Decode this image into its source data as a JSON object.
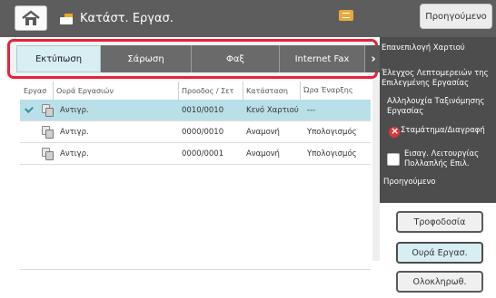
{
  "header": {
    "title": "Κατάστ. Εργασ.",
    "prev_label": "Προηγούμενο"
  },
  "tabs": [
    {
      "label": "Εκτύπωση",
      "active": true
    },
    {
      "label": "Σάρωση",
      "active": false
    },
    {
      "label": "Φαξ",
      "active": false
    },
    {
      "label": "Internet Fax",
      "active": false
    }
  ],
  "table": {
    "columns": [
      "Εργασ",
      "Ουρά Εργασιών",
      "Προοδος / Σετ",
      "Κατάσταση",
      "Ώρα Έναρξης"
    ],
    "rows": [
      {
        "name": "Αντιγρ.",
        "progress": "0010/0010",
        "status": "Κενό Χαρτιού",
        "start": "---",
        "selected": true
      },
      {
        "name": "Αντιγρ.",
        "progress": "0000/0010",
        "status": "Αναμονή",
        "start": "Υπολογισμός",
        "selected": false
      },
      {
        "name": "Αντιγρ.",
        "progress": "0000/0001",
        "status": "Αναμονή",
        "start": "Υπολογισμός",
        "selected": false
      }
    ]
  },
  "side_menu": {
    "items": [
      "Επανεπιλογή Χαρτιού",
      "Έλεγχος Λεπτομερειών της Επιλεγμένης Εργασίας",
      "Αλληλουχία Ταξινόμησης Εργασίας",
      "Σταμάτημα/Διαγραφή",
      "Εισαγ. Λειτουργίας Πολλαπλής Επιλ.",
      "Προηγούμενο"
    ]
  },
  "buttons": {
    "tray": "Τροφοδοσία",
    "queue": "Ουρά Εργασ.",
    "completed": "Ολοκληρωθ."
  },
  "colors": {
    "highlight_frame": "#e8223c",
    "selected_row": "#b9e0e8",
    "active_tab": "#d7eef3",
    "topbar": "#5d5d5d",
    "side_panel": "#4d4d4d"
  }
}
